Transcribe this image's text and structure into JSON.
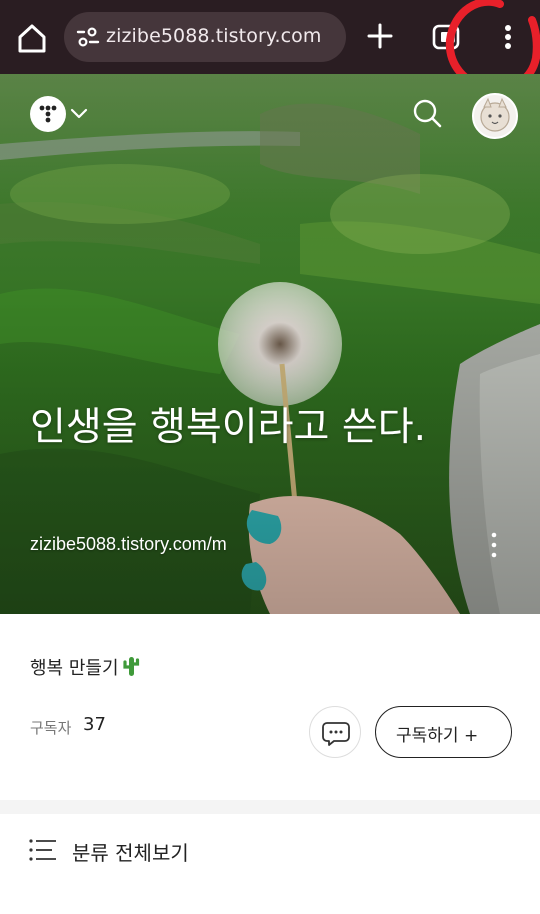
{
  "browser": {
    "url": "zizibe5088.tistory.com",
    "icons": [
      "home-icon",
      "site-settings-icon",
      "new-tab-icon",
      "tab-switcher-icon",
      "more-vert-icon"
    ]
  },
  "hero": {
    "title": "인생을 행복이라고 쓴다.",
    "url": "zizibe5088.tistory.com/m"
  },
  "profile": {
    "intro": "행복 만들기",
    "intro_emoji": "cactus",
    "subscribers_label": "구독자",
    "subscribers_count": "37",
    "subscribe_label": "구독하기 +"
  },
  "category": {
    "label": "분류 전체보기"
  },
  "colors": {
    "toolbar": "#2a1d22",
    "urlbar": "#45363b",
    "annotation": "#e8202a",
    "text_primary": "#222222",
    "text_secondary": "#777777"
  }
}
